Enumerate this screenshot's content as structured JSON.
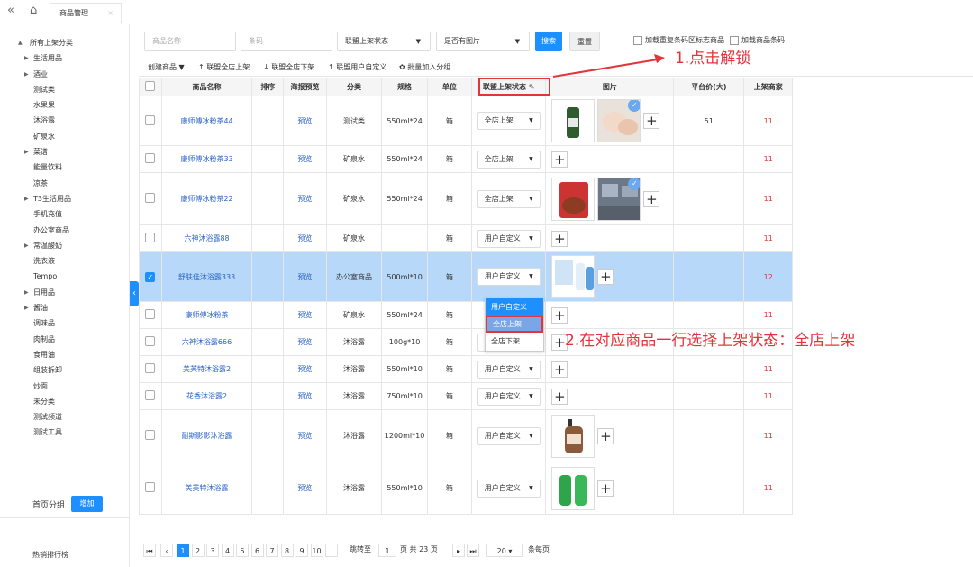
{
  "topbar": {
    "nav_icon": "double-left-chevron",
    "home_icon": "home",
    "tab_label": "商品管理",
    "tab_close": "×"
  },
  "sidebar": {
    "tree": [
      {
        "label": "所有上架分类",
        "level": 0,
        "arrow": "▲"
      },
      {
        "label": "生活用品",
        "level": 1,
        "arrow": "▶"
      },
      {
        "label": "酒业",
        "level": 1,
        "arrow": "▶"
      },
      {
        "label": "测试类",
        "level": 2
      },
      {
        "label": "水果果",
        "level": 2
      },
      {
        "label": "沐浴露",
        "level": 2
      },
      {
        "label": "矿泉水",
        "level": 2
      },
      {
        "label": "菜谱",
        "level": 1,
        "arrow": "▶"
      },
      {
        "label": "能量饮料",
        "level": 2
      },
      {
        "label": "凉茶",
        "level": 2
      },
      {
        "label": "T3生活用品",
        "level": 1,
        "arrow": "▶"
      },
      {
        "label": "手机充值",
        "level": 2
      },
      {
        "label": "办公室商品",
        "level": 2
      },
      {
        "label": "常温酸奶",
        "level": 1,
        "arrow": "▶"
      },
      {
        "label": "洗衣液",
        "level": 2
      },
      {
        "label": "Tempo",
        "level": 2
      },
      {
        "label": "日用品",
        "level": 1,
        "arrow": "▶"
      },
      {
        "label": "酱油",
        "level": 1,
        "arrow": "▶"
      },
      {
        "label": "调味品",
        "level": 2
      },
      {
        "label": "肉制品",
        "level": 2
      },
      {
        "label": "食用油",
        "level": 2
      },
      {
        "label": "组装拆卸",
        "level": 2
      },
      {
        "label": "炒面",
        "level": 2
      },
      {
        "label": "未分类",
        "level": 2
      },
      {
        "label": "测试频道",
        "level": 2
      },
      {
        "label": "测试工具",
        "level": 2
      }
    ],
    "home_group_label": "首页分组",
    "add_button": "增加",
    "hot_rank": "热销排行榜",
    "collapse_icon": "‹"
  },
  "filters": {
    "name_placeholder": "商品名称",
    "barcode_placeholder": "条码",
    "status_select": "联盟上架状态",
    "image_select": "是否有图片",
    "search_button": "搜索",
    "reset_button": "重置",
    "check_dup_label": "加载重复条码区标志商品",
    "check_barcode_label": "加载商品条码"
  },
  "actions": {
    "create": "创建商品 ▼",
    "all_on": "↑ 联盟全店上架",
    "all_off": "↓ 联盟全店下架",
    "user_custom": "↑ 联盟用户自定义",
    "batch_join": "✿ 批量加入分组"
  },
  "table": {
    "headers": [
      "",
      "商品名称",
      "排序",
      "海报预览",
      "分类",
      "规格",
      "单位",
      "联盟上架状态",
      "图片",
      "平台价(大)",
      "上架商家"
    ],
    "rows": [
      {
        "name": "康师傅冰粉茶44",
        "preview": "预览",
        "category": "测试类",
        "spec": "550ml*24",
        "unit": "箱",
        "status": "全店上架",
        "images": [
          "tea-bottle",
          "chicken"
        ],
        "badge": true,
        "price": "51",
        "merchants": "11",
        "tall": true
      },
      {
        "name": "康师傅冰粉茶33",
        "preview": "预览",
        "category": "矿泉水",
        "spec": "550ml*24",
        "unit": "箱",
        "status": "全店上架",
        "images": [],
        "price": "",
        "merchants": "11"
      },
      {
        "name": "康师傅冰粉茶22",
        "preview": "预览",
        "category": "矿泉水",
        "spec": "550ml*24",
        "unit": "箱",
        "status": "全店上架",
        "images": [
          "sausage",
          "office"
        ],
        "badge": true,
        "price": "",
        "merchants": "11",
        "tall": true
      },
      {
        "name": "六神沐浴露88",
        "preview": "预览",
        "category": "矿泉水",
        "spec": "",
        "unit": "箱",
        "status": "用户自定义",
        "images": [],
        "price": "",
        "merchants": "11"
      },
      {
        "name": "舒肤佳沐浴露333",
        "preview": "预览",
        "category": "办公室商品",
        "spec": "500ml*10",
        "unit": "箱",
        "status": "用户自定义",
        "images": [
          "shampoo"
        ],
        "price": "",
        "merchants": "12",
        "tall": true,
        "selected": true
      },
      {
        "name": "康师傅冰粉茶",
        "preview": "预览",
        "category": "矿泉水",
        "spec": "550ml*24",
        "unit": "箱",
        "status": "",
        "images": [],
        "price": "",
        "merchants": "11"
      },
      {
        "name": "六神沐浴露666",
        "preview": "预览",
        "category": "沐浴露",
        "spec": "100g*10",
        "unit": "箱",
        "status": "用户自定义",
        "images": [],
        "price": "",
        "merchants": "11"
      },
      {
        "name": "美芙特沐浴露2",
        "preview": "预览",
        "category": "沐浴露",
        "spec": "550ml*10",
        "unit": "箱",
        "status": "用户自定义",
        "images": [],
        "price": "",
        "merchants": "11"
      },
      {
        "name": "花香沐浴露2",
        "preview": "预览",
        "category": "沐浴露",
        "spec": "750ml*10",
        "unit": "箱",
        "status": "用户自定义",
        "images": [],
        "price": "",
        "merchants": "11"
      },
      {
        "name": "耐斯影影沐浴露",
        "preview": "预览",
        "category": "沐浴露",
        "spec": "1200ml*10",
        "unit": "箱",
        "status": "用户自定义",
        "images": [
          "lotion"
        ],
        "price": "",
        "merchants": "11",
        "tall": true
      },
      {
        "name": "美芙特沐浴露",
        "preview": "预览",
        "category": "沐浴露",
        "spec": "550ml*10",
        "unit": "箱",
        "status": "用户自定义",
        "images": [
          "green-bottles"
        ],
        "price": "",
        "merchants": "11",
        "tall": true
      }
    ]
  },
  "dropdown_options": [
    "用户自定义",
    "全店上架",
    "全店下架"
  ],
  "pager": {
    "pages": [
      "1",
      "2",
      "3",
      "4",
      "5",
      "6",
      "7",
      "8",
      "9",
      "10",
      "..."
    ],
    "goto_label": "跳转至",
    "goto_value": "1",
    "page_total": "页  共 23 页",
    "page_size": "20",
    "per_page": "条每页"
  },
  "annotations": {
    "step1": "1.点击解锁",
    "step2": "2.在对应商品一行选择上架状态：全店上架"
  },
  "colors": {
    "accent": "#1e8fff",
    "annotation": "#e2343b",
    "link": "#2a62c8",
    "selected_row": "#b7d8f8"
  }
}
